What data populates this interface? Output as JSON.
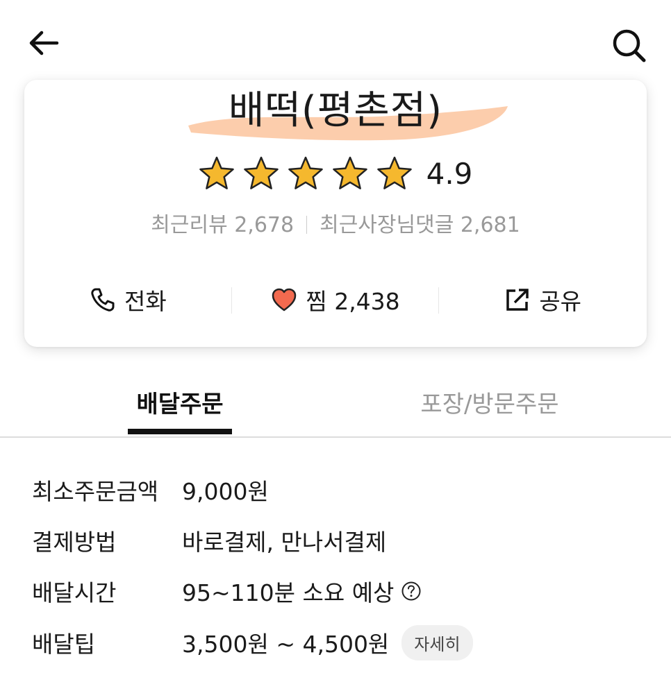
{
  "header": {
    "back_icon": "arrow-left-icon",
    "search_icon": "search-icon"
  },
  "store": {
    "name": "배떡(평촌점)",
    "rating": "4.9",
    "stars": 5,
    "recent_reviews_label": "최근리뷰 2,678",
    "owner_replies_label": "최근사장님댓글 2,681"
  },
  "actions": {
    "call_label": "전화",
    "wish_label": "찜 2,438",
    "share_label": "공유"
  },
  "tabs": {
    "delivery": "배달주문",
    "pickup": "포장/방문주문",
    "active": "delivery"
  },
  "info": {
    "min_order_label": "최소주문금액",
    "min_order_value": "9,000원",
    "payment_label": "결제방법",
    "payment_value": "바로결제, 만나서결제",
    "delivery_time_label": "배달시간",
    "delivery_time_value": "95~110분 소요 예상",
    "delivery_tip_label": "배달팁",
    "delivery_tip_value": "3,500원 ~ 4,500원",
    "detail_button": "자세히"
  },
  "colors": {
    "star": "#f5b82e",
    "heart": "#f26a4f",
    "highlight": "#fbc49e"
  }
}
